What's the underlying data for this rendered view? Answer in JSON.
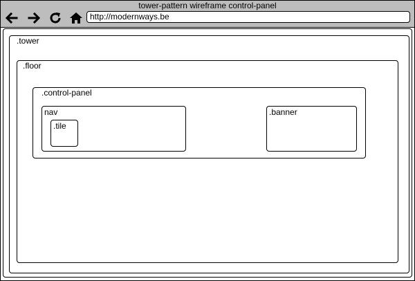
{
  "window": {
    "title": "tower-pattern wireframe control-panel",
    "url": "http://modernways.be"
  },
  "toolbar": {
    "back_icon": "arrow-left-icon",
    "forward_icon": "arrow-right-icon",
    "reload_icon": "reload-icon",
    "home_icon": "home-icon"
  },
  "diagram": {
    "tower": ".tower",
    "floor": ".floor",
    "control_panel": ".control-panel",
    "nav": "nav",
    "tile": ".tile",
    "banner": ".banner"
  }
}
